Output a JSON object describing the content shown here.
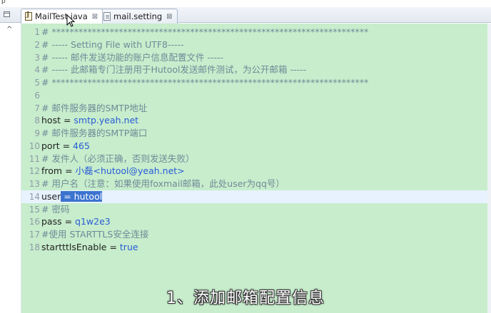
{
  "tabs": [
    {
      "label": "MailTest.java",
      "icon": "java-file-icon",
      "active": true
    },
    {
      "label": "mail.setting",
      "icon": "settings-file-icon",
      "active": false
    }
  ],
  "close_glyph": "⊠",
  "editor": {
    "lines": [
      {
        "num": "1",
        "comment": "# ***********************************************************************",
        "key": "",
        "value": "",
        "selected": ""
      },
      {
        "num": "2",
        "comment": "# ----- Setting File with UTF8-----",
        "key": "",
        "value": "",
        "selected": ""
      },
      {
        "num": "3",
        "comment": "# ----- 邮件发送功能的账户信息配置文件 -----",
        "key": "",
        "value": "",
        "selected": ""
      },
      {
        "num": "4",
        "comment": "# ----- 此邮箱专门注册用于Hutool发送邮件测试，为公开邮箱 -----",
        "key": "",
        "value": "",
        "selected": ""
      },
      {
        "num": "5",
        "comment": "# ***********************************************************************",
        "key": "",
        "value": "",
        "selected": ""
      },
      {
        "num": "6",
        "comment": "",
        "key": "",
        "value": "",
        "selected": ""
      },
      {
        "num": "7",
        "comment": "# 邮件服务器的SMTP地址",
        "key": "",
        "value": "",
        "selected": ""
      },
      {
        "num": "8",
        "comment": "",
        "key": "host = ",
        "value": "smtp.yeah.net",
        "selected": ""
      },
      {
        "num": "9",
        "comment": "# 邮件服务器的SMTP端口",
        "key": "",
        "value": "",
        "selected": ""
      },
      {
        "num": "10",
        "comment": "",
        "key": "port = ",
        "value": "465",
        "selected": ""
      },
      {
        "num": "11",
        "comment": "# 发件人（必须正确，否则发送失败）",
        "key": "",
        "value": "",
        "selected": ""
      },
      {
        "num": "12",
        "comment": "",
        "key": "from = ",
        "value": "小磊<hutool@yeah.net>",
        "selected": ""
      },
      {
        "num": "13",
        "comment": "# 用户名（注意：如果使用foxmail邮箱，此处user为qq号）",
        "key": "",
        "value": "",
        "selected": ""
      },
      {
        "num": "14",
        "comment": "",
        "key": "user",
        "value": "",
        "selected": " = hutool"
      },
      {
        "num": "15",
        "comment": "# 密码",
        "key": "",
        "value": "",
        "selected": ""
      },
      {
        "num": "16",
        "comment": "",
        "key": "pass = ",
        "value": "q1w2e3",
        "selected": ""
      },
      {
        "num": "17",
        "comment": "#使用 STARTTLS安全连接",
        "key": "",
        "value": "",
        "selected": ""
      },
      {
        "num": "18",
        "comment": "",
        "key": "startttlsEnable = ",
        "value": "true",
        "selected": ""
      }
    ],
    "current_line": "14"
  },
  "subtitle": "1、添加邮箱配置信息",
  "colors": {
    "editor_bg": "#c7edcc",
    "current_line": "#e8f2fe",
    "selection": "#3b73cf",
    "value_text": "#2a5bd8",
    "comment_text": "#6f8a98"
  }
}
